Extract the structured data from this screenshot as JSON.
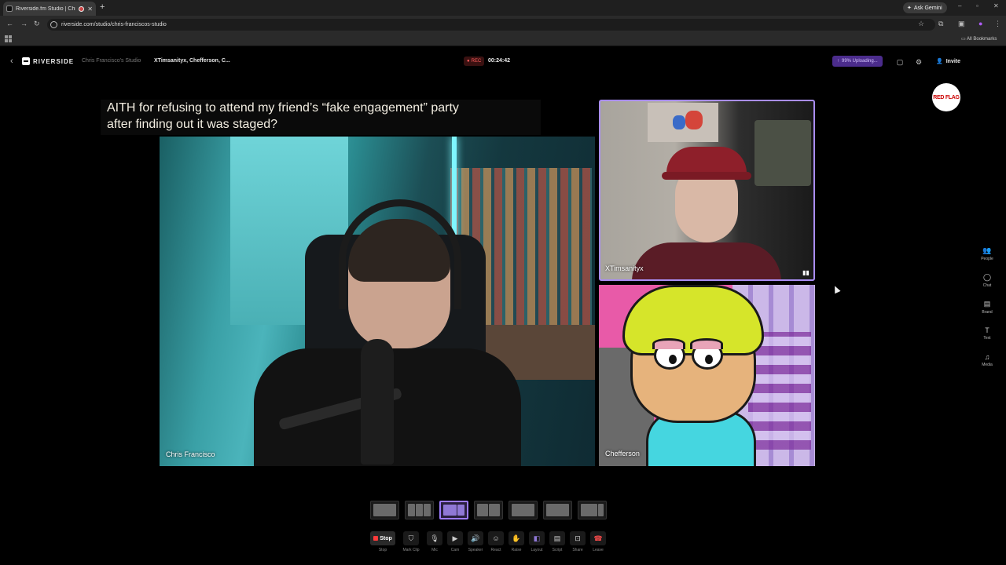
{
  "browser": {
    "tab_title": "Riverside.fm Studio | Chris",
    "new_tab_symbol": "+",
    "ask_gemini": "Ask Gemini",
    "url": "riverside.com/studio/chris-franciscos-studio",
    "all_bookmarks": "All Bookmarks"
  },
  "studio": {
    "brand": "RIVERSIDE",
    "studio_name": "Chris Francisco's Studio",
    "guests_line": "XTimsanityx, Chefferson, C...",
    "rec_label": "REC",
    "timer": "00:24:42",
    "upload_status": "99% Uploading...",
    "invite_label": "Invite",
    "logo_overlay": "RED FLAG"
  },
  "stage": {
    "caption_line1": "AITH for refusing to attend my friend’s “fake engagement” party",
    "caption_line2": "after finding out it was staged?",
    "main_speaker": "Chris Francisco",
    "guest1": "XTimsanityx",
    "guest2": "Chefferson"
  },
  "rail": [
    {
      "icon": "people-icon",
      "label": "People"
    },
    {
      "icon": "chat-icon",
      "label": "Chat"
    },
    {
      "icon": "brand-icon",
      "label": "Brand"
    },
    {
      "icon": "text-icon",
      "label": "Text"
    },
    {
      "icon": "media-icon",
      "label": "Media"
    }
  ],
  "controls": {
    "stop": "Stop",
    "stop_caption": "Stop",
    "mark_clip": "Mark Clip",
    "mic": "Mic",
    "cam": "Cam",
    "speaker": "Speaker",
    "react": "React",
    "raise": "Raise",
    "layout": "Layout",
    "script": "Script",
    "share": "Share",
    "leave": "Leave"
  },
  "colors": {
    "accent": "#9d7bff",
    "rec": "#ff3b3b",
    "upload_bg": "#4b2c8c"
  }
}
